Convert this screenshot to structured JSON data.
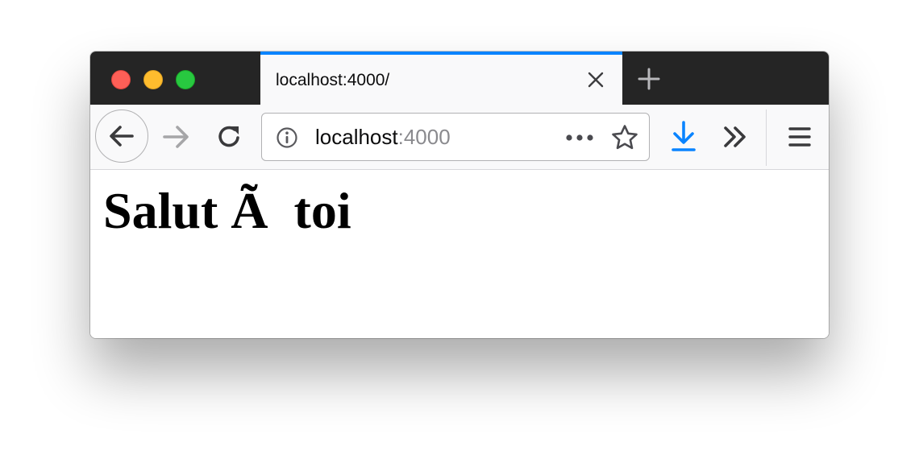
{
  "window": {
    "traffic_lights": {
      "close_color": "#fe5f57",
      "minimize_color": "#febc2e",
      "maximize_color": "#28c840"
    }
  },
  "tabs": [
    {
      "title": "localhost:4000/",
      "active": true,
      "accent_color": "#0a84ff",
      "close_icon": "close-icon"
    }
  ],
  "tabstrip": {
    "new_tab_icon": "plus-icon"
  },
  "toolbar": {
    "back_icon": "arrow-left-icon",
    "forward_icon": "arrow-right-icon",
    "forward_enabled": false,
    "reload_icon": "reload-icon",
    "url_bar": {
      "info_icon": "info-icon",
      "host": "localhost",
      "port": ":4000",
      "page_actions_icon": "more-horizontal-icon",
      "bookmark_icon": "star-icon"
    },
    "download_icon": "download-icon",
    "download_color": "#0a84ff",
    "overflow_icon": "double-chevron-right-icon",
    "menu_icon": "hamburger-menu-icon"
  },
  "page": {
    "heading": "Salut Ã  toi"
  }
}
